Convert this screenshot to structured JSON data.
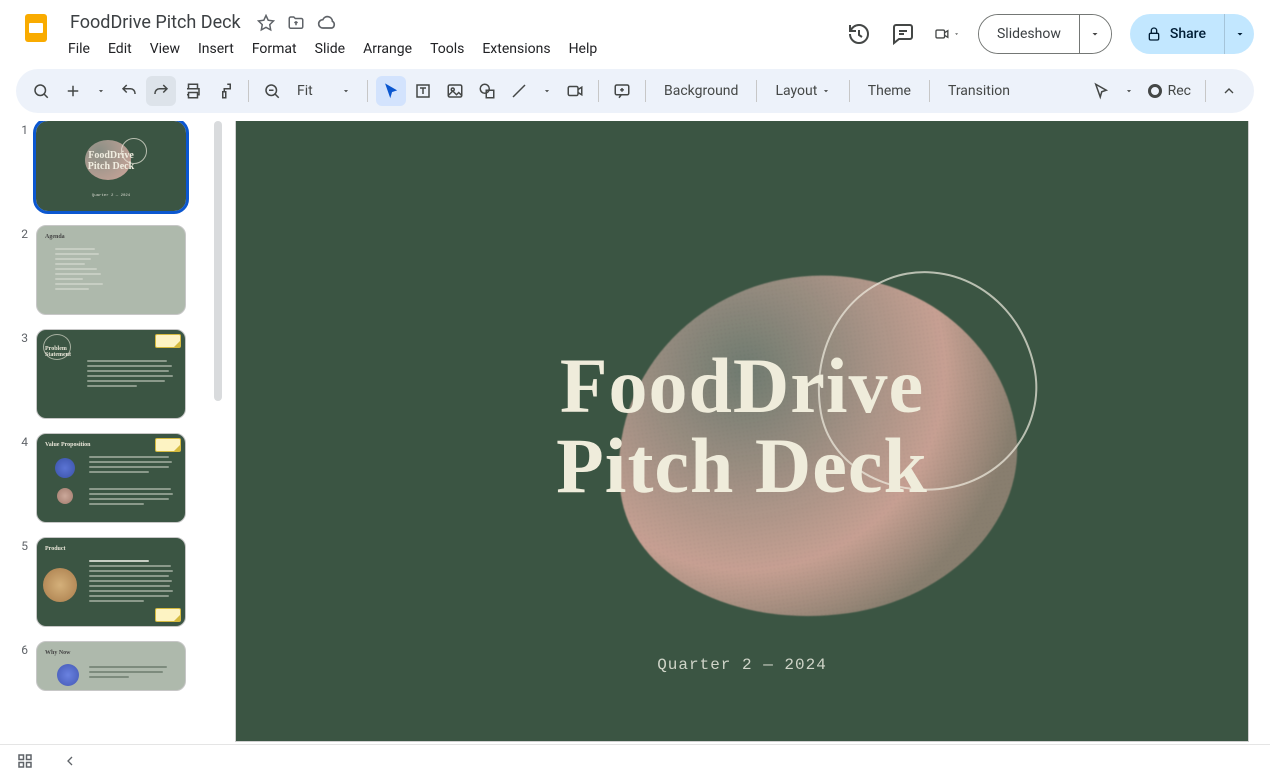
{
  "doc": {
    "title": "FoodDrive Pitch Deck"
  },
  "menu": {
    "file": "File",
    "edit": "Edit",
    "view": "View",
    "insert": "Insert",
    "format": "Format",
    "slide": "Slide",
    "arrange": "Arrange",
    "tools": "Tools",
    "extensions": "Extensions",
    "help": "Help"
  },
  "topright": {
    "slideshow": "Slideshow",
    "share": "Share"
  },
  "toolbar": {
    "zoom": "Fit",
    "background": "Background",
    "layout": "Layout",
    "theme": "Theme",
    "transition": "Transition",
    "rec": "Rec"
  },
  "slide": {
    "title_line1": "FoodDrive",
    "title_line2": "Pitch Deck",
    "subtitle": "Quarter 2 — 2024"
  },
  "thumbs": {
    "n1": "1",
    "n2": "2",
    "n3": "3",
    "n4": "4",
    "n5": "5",
    "n6": "6",
    "t1_line1": "FoodDrive",
    "t1_line2": "Pitch Deck",
    "t1_sub": "Quarter 2 — 2024",
    "t2_heading": "Agenda",
    "t3_heading": "Problem Statement",
    "t4_heading": "Value Proposition",
    "t5_heading": "Product",
    "t6_heading": "Why Now"
  }
}
